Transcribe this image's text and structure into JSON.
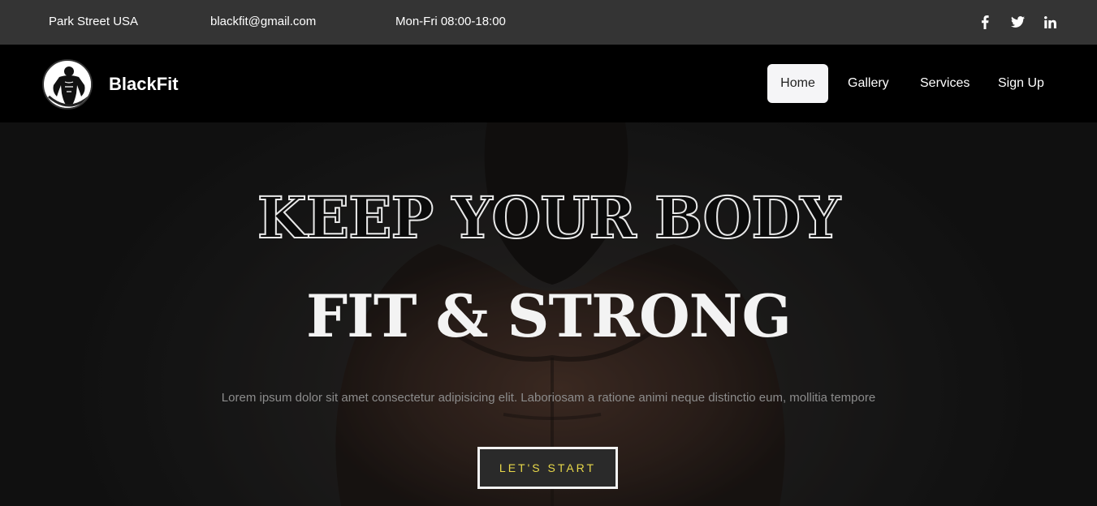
{
  "topbar": {
    "address": "Park Street USA",
    "email": "blackfit@gmail.com",
    "hours": "Mon-Fri 08:00-18:00",
    "social": [
      "facebook-icon",
      "twitter-icon",
      "linkedin-icon"
    ]
  },
  "navbar": {
    "brand": "BlackFit",
    "links": [
      {
        "label": "Home",
        "active": true
      },
      {
        "label": "Gallery",
        "active": false
      },
      {
        "label": "Services",
        "active": false
      },
      {
        "label": "Sign Up",
        "active": false
      }
    ]
  },
  "hero": {
    "headline_outline": "KEEP YOUR BODY",
    "headline_solid": "FIT & STRONG",
    "lead": "Lorem ipsum dolor sit amet consectetur adipisicing elit. Laboriosam a ratione animi neque distinctio eum, mollitia tempore",
    "cta_label": "LET'S START"
  },
  "colors": {
    "topbar_bg": "#343434",
    "navbar_bg": "#000000",
    "active_link_bg": "#f5f5f7",
    "cta_text": "#e8d84a"
  }
}
